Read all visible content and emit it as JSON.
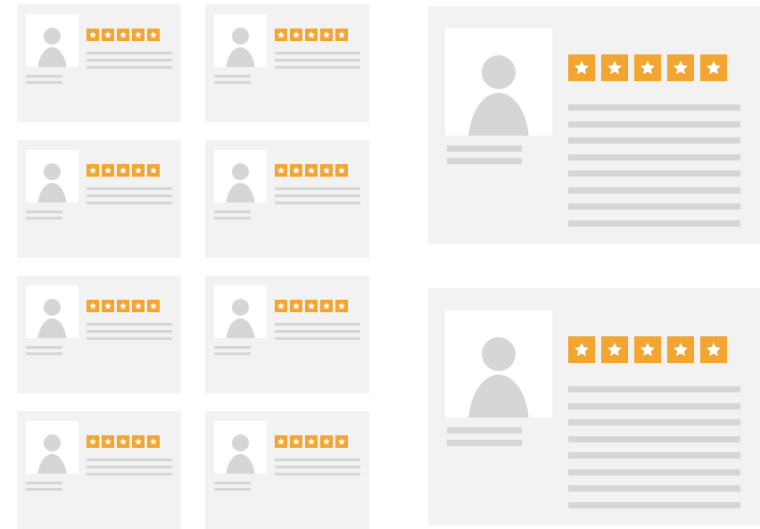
{
  "colors": {
    "background": "#ffffff",
    "card": "#f2f2f2",
    "placeholder": "#d6d6d6",
    "avatar_bg": "#ffffff",
    "star_accent": "#f2a531",
    "star_glyph": "#ffffff"
  },
  "icons": {
    "avatar": "person-silhouette-icon",
    "star": "star-icon"
  },
  "reviews": {
    "small": [
      {
        "rating": 5,
        "max_rating": 5,
        "text_lines": 3
      },
      {
        "rating": 5,
        "max_rating": 5,
        "text_lines": 3
      },
      {
        "rating": 5,
        "max_rating": 5,
        "text_lines": 3
      },
      {
        "rating": 5,
        "max_rating": 5,
        "text_lines": 3
      },
      {
        "rating": 5,
        "max_rating": 5,
        "text_lines": 3
      },
      {
        "rating": 5,
        "max_rating": 5,
        "text_lines": 3
      },
      {
        "rating": 5,
        "max_rating": 5,
        "text_lines": 3
      },
      {
        "rating": 5,
        "max_rating": 5,
        "text_lines": 3
      }
    ],
    "large": [
      {
        "rating": 5,
        "max_rating": 5,
        "text_lines": 8
      },
      {
        "rating": 5,
        "max_rating": 5,
        "text_lines": 8
      }
    ]
  }
}
